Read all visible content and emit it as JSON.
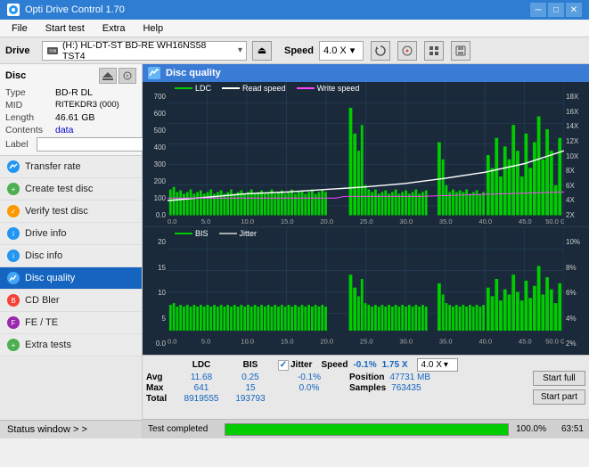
{
  "app": {
    "title": "Opti Drive Control 1.70",
    "icon": "●"
  },
  "titlebar": {
    "title": "Opti Drive Control 1.70",
    "minimize": "─",
    "maximize": "□",
    "close": "✕"
  },
  "menubar": {
    "items": [
      "File",
      "Start test",
      "Extra",
      "Help"
    ]
  },
  "drive_bar": {
    "label": "Drive",
    "drive_name": "(H:)  HL-DT-ST BD-RE  WH16NS58 TST4",
    "speed_label": "Speed",
    "speed_value": "4.0 X",
    "eject_symbol": "⏏"
  },
  "sidebar": {
    "disc_title": "Disc",
    "fields": [
      {
        "label": "Type",
        "value": "BD-R DL",
        "blue": false
      },
      {
        "label": "MID",
        "value": "RITEKDR3 (000)",
        "blue": false
      },
      {
        "label": "Length",
        "value": "46.61 GB",
        "blue": false
      },
      {
        "label": "Contents",
        "value": "data",
        "blue": true
      }
    ],
    "label_field": "Label",
    "label_placeholder": "",
    "nav_items": [
      {
        "id": "transfer-rate",
        "label": "Transfer rate",
        "icon_color": "blue"
      },
      {
        "id": "create-test-disc",
        "label": "Create test disc",
        "icon_color": "green"
      },
      {
        "id": "verify-test-disc",
        "label": "Verify test disc",
        "icon_color": "orange"
      },
      {
        "id": "drive-info",
        "label": "Drive info",
        "icon_color": "blue"
      },
      {
        "id": "disc-info",
        "label": "Disc info",
        "icon_color": "blue"
      },
      {
        "id": "disc-quality",
        "label": "Disc quality",
        "icon_color": "active-icon",
        "active": true
      },
      {
        "id": "cd-bler",
        "label": "CD Bler",
        "icon_color": "red"
      },
      {
        "id": "fe-te",
        "label": "FE / TE",
        "icon_color": "purple"
      },
      {
        "id": "extra-tests",
        "label": "Extra tests",
        "icon_color": "green"
      }
    ],
    "status_window": "Status window > >"
  },
  "panel": {
    "title": "Disc quality",
    "legend": {
      "ldc": "LDC",
      "read_speed": "Read speed",
      "write_speed": "Write speed",
      "bis": "BIS",
      "jitter": "Jitter"
    }
  },
  "chart1": {
    "y_left_labels": [
      "700",
      "600",
      "500",
      "400",
      "300",
      "200",
      "100",
      "0.0"
    ],
    "y_right_labels": [
      "18X",
      "16X",
      "14X",
      "12X",
      "10X",
      "8X",
      "6X",
      "4X",
      "2X"
    ],
    "x_labels": [
      "0.0",
      "5.0",
      "10.0",
      "15.0",
      "20.0",
      "25.0",
      "30.0",
      "35.0",
      "40.0",
      "45.0",
      "50.0 GB"
    ]
  },
  "chart2": {
    "y_left_labels": [
      "20",
      "15",
      "10",
      "5",
      "0.0"
    ],
    "y_right_labels": [
      "10%",
      "8%",
      "6%",
      "4%",
      "2%"
    ],
    "x_labels": [
      "0.0",
      "5.0",
      "10.0",
      "15.0",
      "20.0",
      "25.0",
      "30.0",
      "35.0",
      "40.0",
      "45.0",
      "50.0 GB"
    ]
  },
  "stats": {
    "headers": [
      "LDC",
      "BIS",
      "",
      "Jitter",
      "Speed",
      "1.75 X",
      "",
      "4.0 X"
    ],
    "avg_ldc": "11.68",
    "avg_bis": "0.25",
    "avg_jitter": "-0.1%",
    "max_ldc": "641",
    "max_bis": "15",
    "max_jitter": "0.0%",
    "total_ldc": "8919555",
    "total_bis": "193793",
    "position_label": "Position",
    "position_val": "47731 MB",
    "samples_label": "Samples",
    "samples_val": "763435",
    "btn_start_full": "Start full",
    "btn_start_part": "Start part",
    "row_labels": [
      "Avg",
      "Max",
      "Total"
    ]
  },
  "progress": {
    "status": "Test completed",
    "percent": "100.0%",
    "percent_value": 100,
    "time": "63:51"
  }
}
